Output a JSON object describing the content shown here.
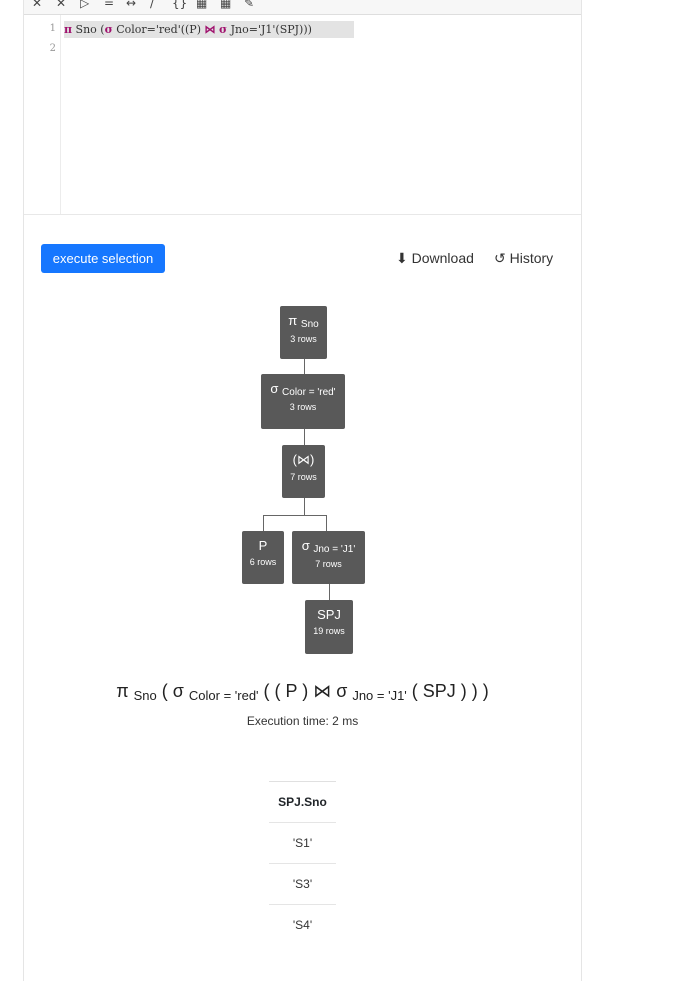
{
  "toolbar": {
    "icons": [
      "collapse-icon",
      "expand-icon",
      "play-icon",
      "equals-icon",
      "minus-icon",
      "slash-icon",
      "braces-icon",
      "table-icon",
      "grid-icon",
      "brush-icon"
    ],
    "glyphs": [
      "✕",
      "✕",
      "▷",
      "=",
      "↔",
      "/",
      "{}",
      "▦",
      "▦",
      "✎"
    ]
  },
  "editor": {
    "line_numbers": [
      "1",
      "2"
    ],
    "tokens": [
      {
        "text": "π",
        "kind": "kw"
      },
      {
        "text": " Sno (",
        "kind": "plain"
      },
      {
        "text": "σ",
        "kind": "kw"
      },
      {
        "text": " Color='red'((P) ",
        "kind": "plain"
      },
      {
        "text": "⋈",
        "kind": "kw"
      },
      {
        "text": " ",
        "kind": "plain"
      },
      {
        "text": "σ",
        "kind": "kw"
      },
      {
        "text": " Jno='J1'(SPJ)))",
        "kind": "plain"
      }
    ]
  },
  "actions": {
    "execute_label": "execute selection",
    "download_label": "Download",
    "history_label": "History"
  },
  "tree": {
    "n1": {
      "op": "π",
      "sub": "Sno",
      "rows": "3 rows"
    },
    "n2": {
      "op": "σ",
      "sub": "Color = 'red'",
      "rows": "3 rows"
    },
    "n3": {
      "op": "(⋈)",
      "sub": "",
      "rows": "7 rows"
    },
    "n4": {
      "op": "P",
      "sub": "",
      "rows": "6 rows"
    },
    "n5": {
      "op": "σ",
      "sub": "Jno = 'J1'",
      "rows": "7 rows"
    },
    "n6": {
      "op": "SPJ",
      "sub": "",
      "rows": "19 rows"
    }
  },
  "result": {
    "expression": {
      "p1": "π",
      "s1": "Sno",
      "p2": " ( σ ",
      "s2": "Color = 'red'",
      "p3": " ( ( P ) ⋈ σ ",
      "s3": "Jno = 'J1'",
      "p4": " ( SPJ ) ) )"
    },
    "execution_time": "Execution time: 2 ms",
    "table": {
      "header": "SPJ.Sno",
      "rows": [
        "'S1'",
        "'S3'",
        "'S4'"
      ]
    }
  }
}
